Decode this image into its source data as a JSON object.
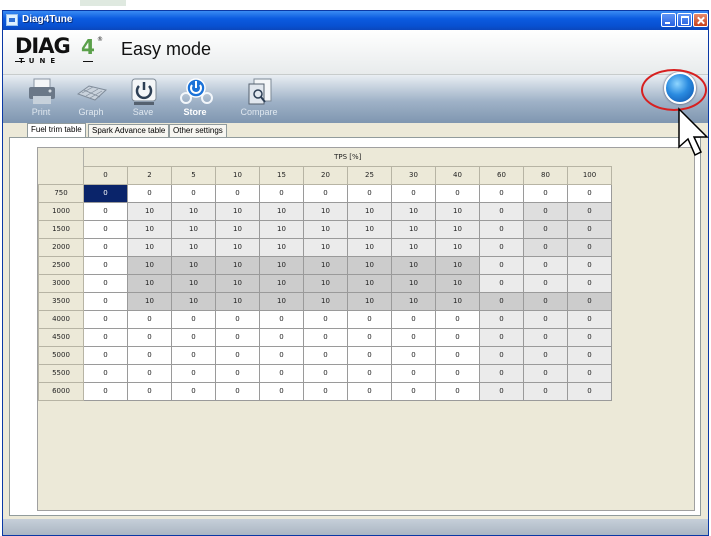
{
  "window": {
    "title": "Diag4Tune"
  },
  "header": {
    "logo": {
      "main": "DIAG",
      "four": "4",
      "tune": "TUNE"
    },
    "mode_title": "Easy mode"
  },
  "toolbar": {
    "buttons": [
      {
        "id": "print",
        "label": "Print",
        "icon": "printer-icon"
      },
      {
        "id": "graph",
        "label": "Graph",
        "icon": "graph-surface-icon"
      },
      {
        "id": "save",
        "label": "Save",
        "icon": "save-power-icon"
      },
      {
        "id": "store",
        "label": "Store",
        "icon": "store-engine-icon"
      },
      {
        "id": "compare",
        "label": "Compare",
        "icon": "compare-documents-icon"
      }
    ],
    "right_icon": "globe-icon"
  },
  "tabs": [
    {
      "label": "Fuel trim table",
      "active": true
    },
    {
      "label": "Spark Advance table",
      "active": false
    },
    {
      "label": "Other settings",
      "active": false
    }
  ],
  "table": {
    "axis_title": "TPS [%]",
    "columns": [
      "0",
      "2",
      "5",
      "10",
      "15",
      "20",
      "25",
      "30",
      "40",
      "60",
      "80",
      "100"
    ],
    "rows": [
      {
        "rpm": "750",
        "values": [
          "0",
          "0",
          "0",
          "0",
          "0",
          "0",
          "0",
          "0",
          "0",
          "0",
          "0",
          "0"
        ]
      },
      {
        "rpm": "1000",
        "values": [
          "0",
          "10",
          "10",
          "10",
          "10",
          "10",
          "10",
          "10",
          "10",
          "0",
          "0",
          "0"
        ]
      },
      {
        "rpm": "1500",
        "values": [
          "0",
          "10",
          "10",
          "10",
          "10",
          "10",
          "10",
          "10",
          "10",
          "0",
          "0",
          "0"
        ]
      },
      {
        "rpm": "2000",
        "values": [
          "0",
          "10",
          "10",
          "10",
          "10",
          "10",
          "10",
          "10",
          "10",
          "0",
          "0",
          "0"
        ]
      },
      {
        "rpm": "2500",
        "values": [
          "0",
          "10",
          "10",
          "10",
          "10",
          "10",
          "10",
          "10",
          "10",
          "0",
          "0",
          "0"
        ]
      },
      {
        "rpm": "3000",
        "values": [
          "0",
          "10",
          "10",
          "10",
          "10",
          "10",
          "10",
          "10",
          "10",
          "0",
          "0",
          "0"
        ]
      },
      {
        "rpm": "3500",
        "values": [
          "0",
          "10",
          "10",
          "10",
          "10",
          "10",
          "10",
          "10",
          "10",
          "0",
          "0",
          "0"
        ]
      },
      {
        "rpm": "4000",
        "values": [
          "0",
          "0",
          "0",
          "0",
          "0",
          "0",
          "0",
          "0",
          "0",
          "0",
          "0",
          "0"
        ]
      },
      {
        "rpm": "4500",
        "values": [
          "0",
          "0",
          "0",
          "0",
          "0",
          "0",
          "0",
          "0",
          "0",
          "0",
          "0",
          "0"
        ]
      },
      {
        "rpm": "5000",
        "values": [
          "0",
          "0",
          "0",
          "0",
          "0",
          "0",
          "0",
          "0",
          "0",
          "0",
          "0",
          "0"
        ]
      },
      {
        "rpm": "5500",
        "values": [
          "0",
          "0",
          "0",
          "0",
          "0",
          "0",
          "0",
          "0",
          "0",
          "0",
          "0",
          "0"
        ]
      },
      {
        "rpm": "6000",
        "values": [
          "0",
          "0",
          "0",
          "0",
          "0",
          "0",
          "0",
          "0",
          "0",
          "0",
          "0",
          "0"
        ]
      }
    ],
    "shades": [
      "swwwwwwwwwww",
      "wlllllllllmm",
      "wlllllllllmm",
      "wlllllllllmm",
      "wddddddddlll",
      "wddddddddlll",
      "wddddddddddd",
      "wwwwwwwwwlll",
      "wwwwwwwwwlll",
      "wwwwwwwwwlll",
      "wwwwwwwwwlll",
      "wwwwwwwwwlll"
    ],
    "selected": {
      "row": 0,
      "col": 0
    }
  },
  "colors": {
    "titlebar": "#0b5be0",
    "selection": "#0a246a",
    "highlight_circle": "#d72020",
    "logo_accent": "#5aa04a"
  }
}
